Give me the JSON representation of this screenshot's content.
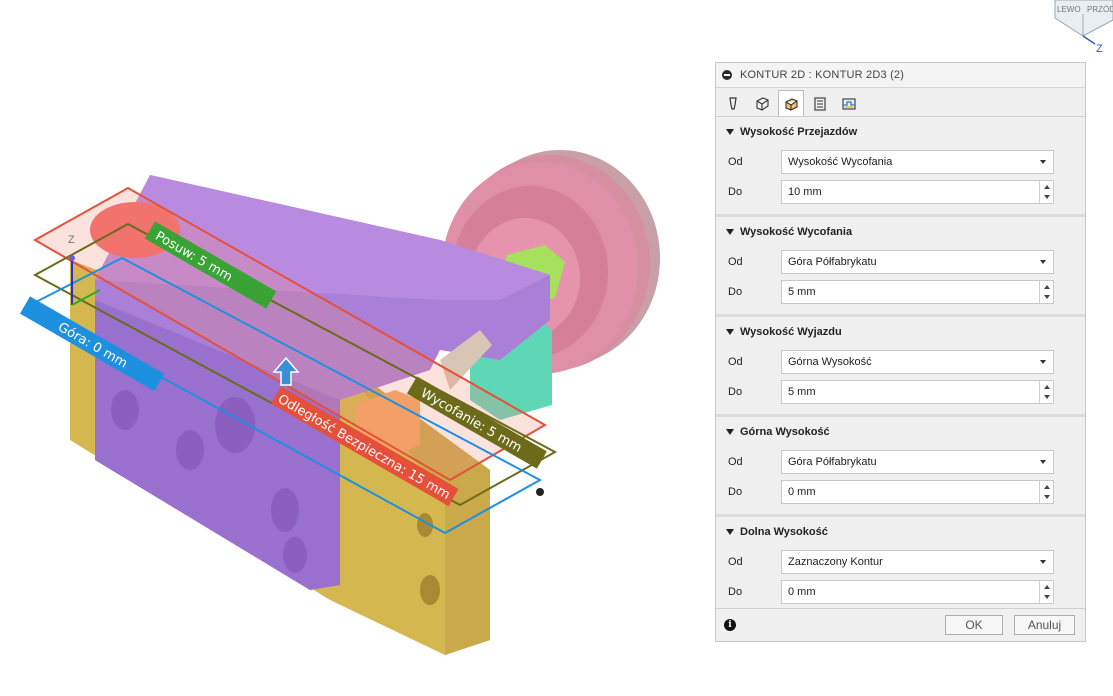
{
  "viewcube": {
    "face_left": "LEWO",
    "face_right": "PRZÓD",
    "axis": "Z"
  },
  "viewport": {
    "axis_label": "Z",
    "labels": {
      "posuw": "Posuw: 5 mm",
      "gora": "Góra: 0 mm",
      "wycofanie": "Wycofanie: 5 mm",
      "odleglosc": "Odległość Bezpieczna: 15 mm"
    },
    "colors": {
      "posuw": "#3aa335",
      "gora": "#1e90e0",
      "wycofanie": "#6b6b1a",
      "odleglosc": "#e5503a"
    }
  },
  "dialog": {
    "title": "KONTUR 2D : KONTUR 2D3 (2)",
    "tabs": [
      "tool-icon",
      "geometry-icon",
      "heights-icon",
      "passes-icon",
      "linking-icon"
    ],
    "active_tab": 2,
    "sections": [
      {
        "title": "Wysokość Przejazdów",
        "od_label": "Od",
        "od_value": "Wysokość Wycofania",
        "do_label": "Do",
        "do_value": "10 mm"
      },
      {
        "title": "Wysokość Wycofania",
        "od_label": "Od",
        "od_value": "Góra Półfabrykatu",
        "do_label": "Do",
        "do_value": "5 mm"
      },
      {
        "title": "Wysokość Wyjazdu",
        "od_label": "Od",
        "od_value": "Górna Wysokość",
        "do_label": "Do",
        "do_value": "5 mm"
      },
      {
        "title": "Górna Wysokość",
        "od_label": "Od",
        "od_value": "Góra Półfabrykatu",
        "do_label": "Do",
        "do_value": "0 mm"
      },
      {
        "title": "Dolna Wysokość",
        "od_label": "Od",
        "od_value": "Zaznaczony Kontur",
        "do_label": "Do",
        "do_value": "0 mm"
      }
    ],
    "ok_label": "OK",
    "cancel_label": "Anuluj"
  }
}
